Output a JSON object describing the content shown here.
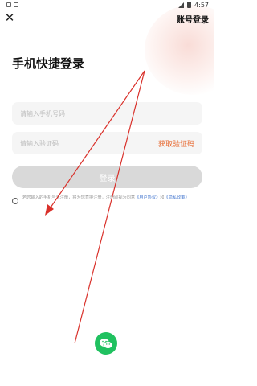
{
  "status_bar": {
    "time": "4:57"
  },
  "header": {
    "close_symbol": "✕",
    "account_login": "账号登录"
  },
  "title": "手机快捷登录",
  "phone_input": {
    "placeholder": "请输入手机号码",
    "value": ""
  },
  "code_input": {
    "placeholder": "请输入验证码",
    "value": ""
  },
  "get_code_label": "获取验证码",
  "login_label": "登录",
  "agreement": {
    "text": "若您输入的手机号未注册，将为您直接注册，注册即视为同意",
    "user_agreement": "《用户协议》",
    "and": "和",
    "privacy_policy": "《隐私政策》"
  },
  "colors": {
    "accent": "#e8703a",
    "wechat": "#20c160",
    "login_disabled": "#d9d9d9",
    "link": "#4a7bd0",
    "annotation": "#d9302a"
  },
  "icons": {
    "close": "close-icon",
    "wechat": "wechat-icon",
    "radio": "radio-unchecked-icon"
  }
}
